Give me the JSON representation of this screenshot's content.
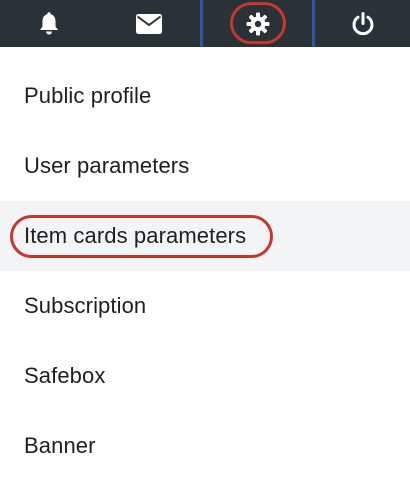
{
  "topbar": {
    "background": "#2a3238",
    "buttons": [
      {
        "id": "notifications",
        "icon": "bell-icon"
      },
      {
        "id": "messages",
        "icon": "envelope-icon"
      },
      {
        "id": "settings",
        "icon": "gear-icon",
        "active": true
      },
      {
        "id": "logout",
        "icon": "power-icon"
      }
    ]
  },
  "settings_menu": {
    "items": [
      {
        "label": "Public profile"
      },
      {
        "label": "User parameters"
      },
      {
        "label": "Item cards parameters",
        "highlighted": true
      },
      {
        "label": "Subscription"
      },
      {
        "label": "Safebox"
      },
      {
        "label": "Banner"
      }
    ]
  },
  "colors": {
    "highlight_ring": "#c8372d",
    "active_tab_border": "#2f54a8",
    "active_item_bg": "#f3f4f6"
  }
}
